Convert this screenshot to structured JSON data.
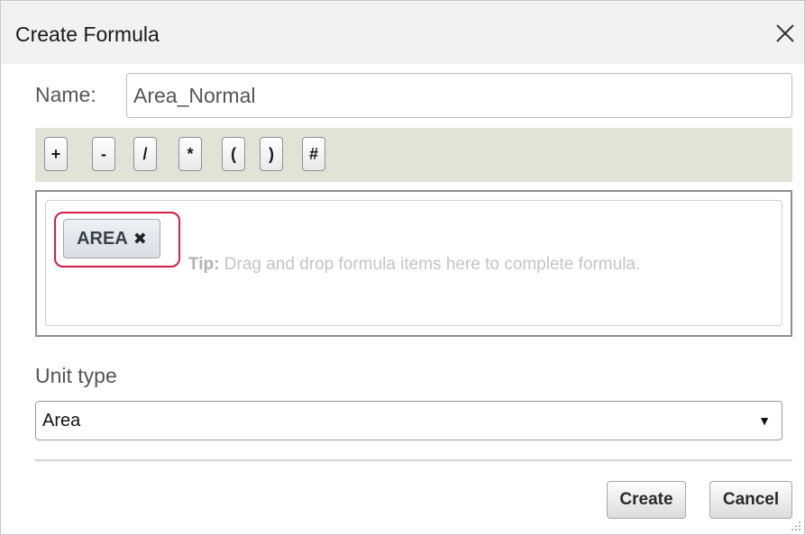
{
  "dialog": {
    "title": "Create Formula",
    "close_icon": "close-icon"
  },
  "name": {
    "label": "Name:",
    "value": "Area_Normal"
  },
  "operators": [
    "+",
    "-",
    "/",
    "*",
    "(",
    ")",
    "#"
  ],
  "formula": {
    "chip_label": "AREA",
    "chip_remove_icon": "x-icon",
    "tip_prefix": "Tip:",
    "tip_text": "Drag and drop formula items here to complete formula.",
    "highlight_color": "#d11e43"
  },
  "unit_type": {
    "label": "Unit type",
    "selected": "Area",
    "dropdown_icon": "caret-down-icon"
  },
  "actions": {
    "create_label": "Create",
    "cancel_label": "Cancel"
  }
}
